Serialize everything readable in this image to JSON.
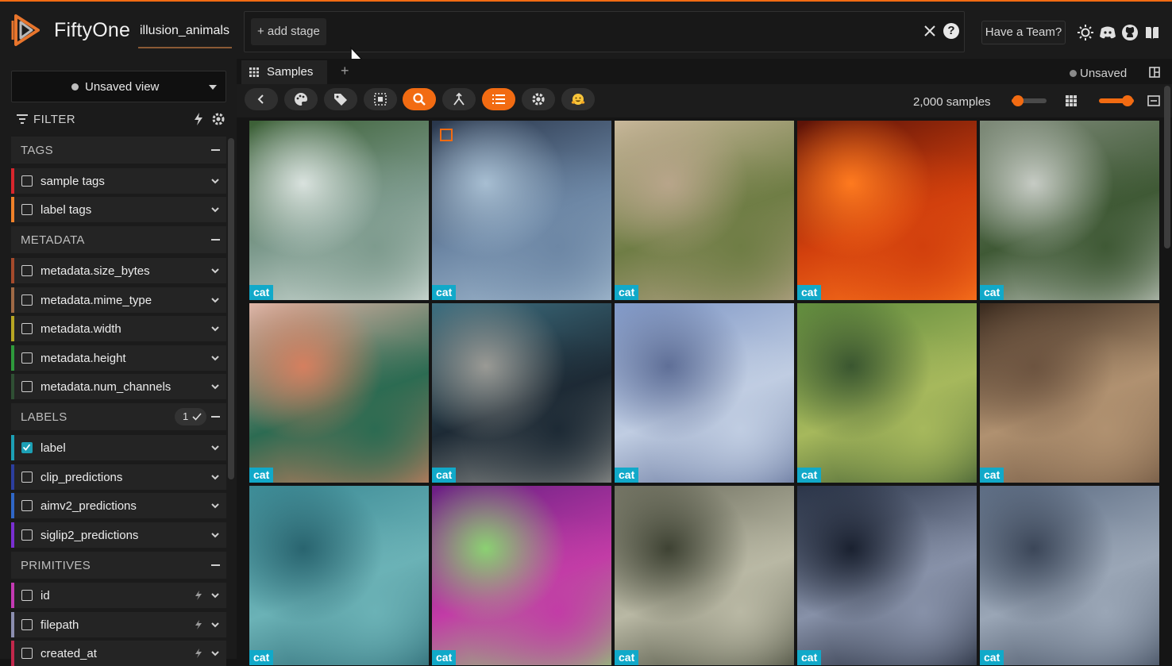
{
  "app": {
    "name": "FiftyOne",
    "dataset": "illusion_animals"
  },
  "viewbar": {
    "add_stage": "+ add stage"
  },
  "header": {
    "team_button": "Have a Team?"
  },
  "sidebar": {
    "view_select": "Unsaved view",
    "filter_label": "FILTER",
    "groups": {
      "tags": "TAGS",
      "metadata": "METADATA",
      "labels": "LABELS",
      "labels_count": "1",
      "primitives": "PRIMITIVES"
    },
    "fields": {
      "sample_tags": "sample tags",
      "label_tags": "label tags",
      "size_bytes": "metadata.size_bytes",
      "mime_type": "metadata.mime_type",
      "width": "metadata.width",
      "height": "metadata.height",
      "num_channels": "metadata.num_channels",
      "label": "label",
      "clip": "clip_predictions",
      "aimv2": "aimv2_predictions",
      "siglip2": "siglip2_predictions",
      "id": "id",
      "filepath": "filepath",
      "created_at": "created_at"
    }
  },
  "main": {
    "tab": "Samples",
    "tab_add": "+",
    "status": "Unsaved",
    "count": "2,000 samples"
  },
  "samples": [
    {
      "label": "cat",
      "colors": [
        "#3b5f35",
        "#7e9b8e",
        "#d9e2de"
      ]
    },
    {
      "label": "cat",
      "colors": [
        "#28354a",
        "#6d87a5",
        "#a7bed2"
      ]
    },
    {
      "label": "cat",
      "colors": [
        "#c8b79a",
        "#6f7d45",
        "#b8a58a"
      ]
    },
    {
      "label": "cat",
      "colors": [
        "#5a1208",
        "#d2400d",
        "#ff7a1f"
      ]
    },
    {
      "label": "cat",
      "colors": [
        "#7e8a79",
        "#3f5935",
        "#c6cbc4"
      ]
    },
    {
      "label": "cat",
      "colors": [
        "#e0b4a6",
        "#2c6b52",
        "#d57f5f"
      ]
    },
    {
      "label": "cat",
      "colors": [
        "#3d6f80",
        "#1d2a35",
        "#9a9a95"
      ]
    },
    {
      "label": "cat",
      "colors": [
        "#7f97c6",
        "#c0cde2",
        "#5f6f97"
      ]
    },
    {
      "label": "cat",
      "colors": [
        "#5f8a3c",
        "#a6b85c",
        "#3a5630"
      ]
    },
    {
      "label": "cat",
      "colors": [
        "#3a2a1e",
        "#b09170",
        "#6d5440"
      ]
    },
    {
      "label": "cat",
      "colors": [
        "#3b8a95",
        "#6bb2b6",
        "#29646f"
      ]
    },
    {
      "label": "cat",
      "colors": [
        "#6a1f84",
        "#c23ca6",
        "#8bd172"
      ]
    },
    {
      "label": "cat",
      "colors": [
        "#6f7060",
        "#b9b8a4",
        "#3e4233"
      ]
    },
    {
      "label": "cat",
      "colors": [
        "#2a3448",
        "#8791a8",
        "#1a2130"
      ]
    },
    {
      "label": "cat",
      "colors": [
        "#5b6b82",
        "#9aa6b6",
        "#3b4658"
      ]
    }
  ],
  "accent": "#f26b12",
  "label_color": "#11a9c9"
}
